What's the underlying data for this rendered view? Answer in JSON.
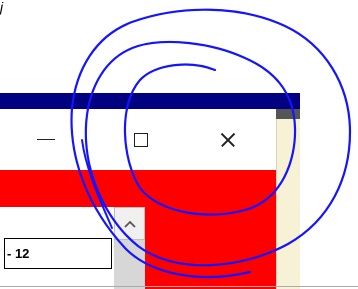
{
  "top_partial": {
    "text": "j"
  },
  "window": {
    "controls": {
      "minimize": "minimize-icon",
      "maximize": "maximize-icon",
      "close": "close-icon"
    }
  },
  "field": {
    "value": "- 12"
  },
  "scrollbar": {
    "up_icon": "chevron-up-icon"
  },
  "colors": {
    "title_bar": "#000080",
    "red_panel": "#ff0000",
    "scribble": "#1414ff",
    "right_frame": "#f7f1d6"
  }
}
